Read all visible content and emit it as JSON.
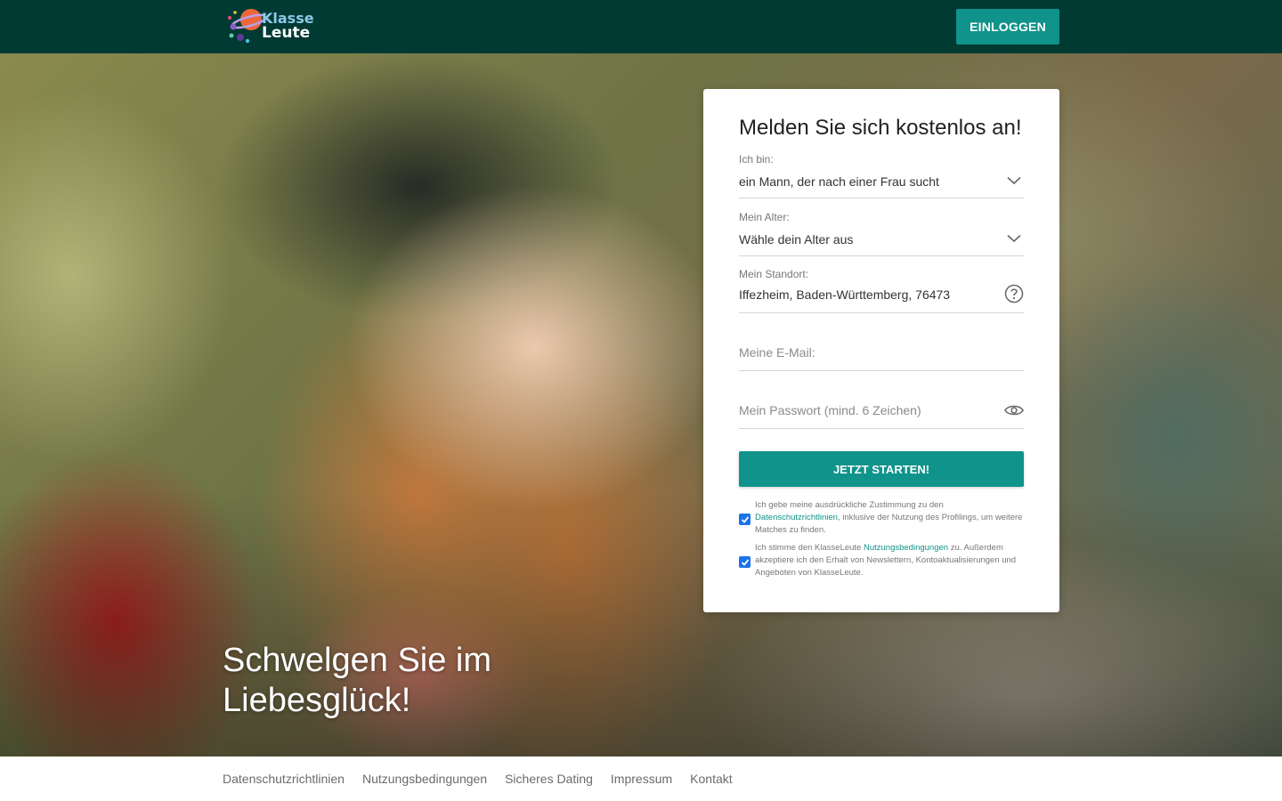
{
  "header": {
    "logo": {
      "line1": "Klasse",
      "line2": "Leute"
    },
    "login_label": "EINLOGGEN",
    "bg_color": "#003a33",
    "accent": "#10938a"
  },
  "hero": {
    "title": "Schwelgen Sie im Liebesglück!"
  },
  "form": {
    "title": "Melden Sie sich kostenlos an!",
    "seeking": {
      "label": "Ich bin:",
      "value": "ein Mann, der nach einer Frau sucht",
      "icon": "chevron-down-icon"
    },
    "age": {
      "label": "Mein Alter:",
      "value": "Wähle dein Alter aus",
      "icon": "chevron-down-icon"
    },
    "location": {
      "label": "Mein Standort:",
      "value": "Iffezheim, Baden-Württemberg, 76473",
      "icon": "help-icon"
    },
    "email": {
      "placeholder": "Meine E-Mail:"
    },
    "password": {
      "placeholder": "Mein Passwort (mind. 6 Zeichen)",
      "icon": "eye-icon"
    },
    "submit_label": "JETZT STARTEN!",
    "consent_privacy": {
      "checked": true,
      "before": "Ich gebe meine ausdrückliche Zustimmung zu den ",
      "link": "Datenschutzrichtlinien",
      "after": ", inklusive der Nutzung des Profilings, um weitere Matches zu finden."
    },
    "consent_terms": {
      "checked": true,
      "before": "Ich stimme den KlasseLeute ",
      "link": "Nutzungsbedingungen",
      "after": " zu. Außerdem akzeptiere ich den Erhalt von Newslettern, Kontoaktualisierungen und Angeboten von KlasseLeute."
    }
  },
  "footer": {
    "links": [
      "Datenschutzrichtlinien",
      "Nutzungsbedingungen",
      "Sicheres Dating",
      "Impressum",
      "Kontakt"
    ]
  }
}
